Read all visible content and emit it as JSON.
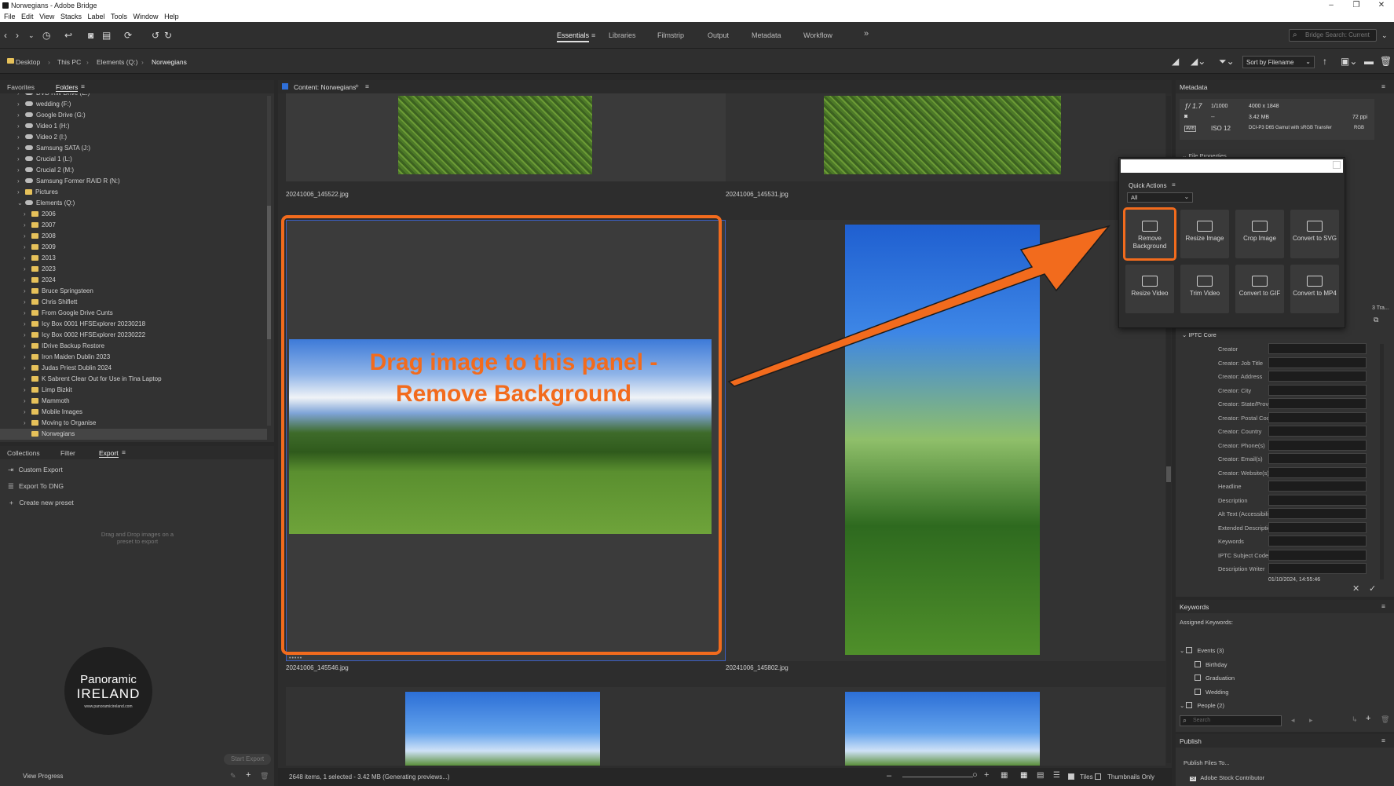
{
  "window": {
    "title": "Norwegians - Adobe Bridge"
  },
  "menu": [
    "File",
    "Edit",
    "View",
    "Stacks",
    "Label",
    "Tools",
    "Window",
    "Help"
  ],
  "workspaces": [
    "Essentials",
    "Libraries",
    "Filmstrip",
    "Output",
    "Metadata",
    "Workflow"
  ],
  "search": {
    "placeholder": "Bridge Search: Current"
  },
  "breadcrumbs": [
    "Desktop",
    "This PC",
    "Elements (Q:)",
    "Norwegians"
  ],
  "sort": {
    "selected": "Sort by Filename"
  },
  "left": {
    "tabs": [
      "Favorites",
      "Folders"
    ],
    "folders": [
      {
        "label": "DVD RW Drive (E:)",
        "type": "drive",
        "indent": 1
      },
      {
        "label": "wedding (F:)",
        "type": "drive",
        "indent": 1
      },
      {
        "label": "Google Drive (G:)",
        "type": "drive",
        "indent": 1
      },
      {
        "label": "Video 1 (H:)",
        "type": "drive",
        "indent": 1
      },
      {
        "label": "Video 2 (I:)",
        "type": "drive",
        "indent": 1
      },
      {
        "label": "Samsung SATA (J:)",
        "type": "drive",
        "indent": 1
      },
      {
        "label": "Crucial 1 (L:)",
        "type": "drive",
        "indent": 1
      },
      {
        "label": "Crucial 2 (M:)",
        "type": "drive",
        "indent": 1
      },
      {
        "label": "Samsung Former RAID R (N:)",
        "type": "drive",
        "indent": 1
      },
      {
        "label": "Pictures",
        "type": "folder",
        "indent": 1
      },
      {
        "label": "Elements (Q:)",
        "type": "drive",
        "indent": 1,
        "open": true
      },
      {
        "label": "2006",
        "type": "folder",
        "indent": 2
      },
      {
        "label": "2007",
        "type": "folder",
        "indent": 2
      },
      {
        "label": "2008",
        "type": "folder",
        "indent": 2
      },
      {
        "label": "2009",
        "type": "folder",
        "indent": 2
      },
      {
        "label": "2013",
        "type": "folder",
        "indent": 2
      },
      {
        "label": "2023",
        "type": "folder",
        "indent": 2
      },
      {
        "label": "2024",
        "type": "folder",
        "indent": 2
      },
      {
        "label": "Bruce Springsteen",
        "type": "folder",
        "indent": 2
      },
      {
        "label": "Chris Shiflett",
        "type": "folder",
        "indent": 2
      },
      {
        "label": "From Google Drive Cunts",
        "type": "folder",
        "indent": 2
      },
      {
        "label": "Icy Box 0001 HFSExplorer 20230218",
        "type": "folder",
        "indent": 2
      },
      {
        "label": "Icy Box 0002 HFSExplorer 20230222",
        "type": "folder",
        "indent": 2
      },
      {
        "label": "IDrive Backup Restore",
        "type": "folder",
        "indent": 2
      },
      {
        "label": "Iron Maiden Dublin 2023",
        "type": "folder",
        "indent": 2
      },
      {
        "label": "Judas Priest Dublin 2024",
        "type": "folder",
        "indent": 2
      },
      {
        "label": "K Sabrent Clear Out for Use in Tina Laptop",
        "type": "folder",
        "indent": 2
      },
      {
        "label": "Limp Bizkit",
        "type": "folder",
        "indent": 2
      },
      {
        "label": "Mammoth",
        "type": "folder",
        "indent": 2
      },
      {
        "label": "Mobile Images",
        "type": "folder",
        "indent": 2
      },
      {
        "label": "Moving to Organise",
        "type": "folder",
        "indent": 2
      },
      {
        "label": "Norwegians",
        "type": "folder",
        "indent": 2,
        "selected": true
      }
    ],
    "bottom_tabs": [
      "Collections",
      "Filter",
      "Export"
    ],
    "export_items": [
      "Custom Export",
      "Export To DNG",
      "Create new preset"
    ],
    "drag_hint": "Drag and Drop images on a preset to export",
    "start_export": "Start Export",
    "view_progress": "View Progress",
    "logo": {
      "line1": "Panoramic",
      "line2": "IRELAND",
      "url": "www.panoramicireland.com"
    }
  },
  "content": {
    "header": "Content: Norwegians",
    "files": [
      "20241006_145522.jpg",
      "20241006_145531.jpg",
      "20241006_145546.jpg",
      "20241006_145802.jpg"
    ],
    "annotation": {
      "line1": "Drag image to this panel -",
      "line2": "Remove Background"
    },
    "status": "2648 items, 1 selected - 3.42 MB (Generating previews...)",
    "view_options": {
      "tiles": "Tiles",
      "thumbs_only": "Thumbnails Only"
    }
  },
  "metadata": {
    "header": "Metadata",
    "aperture": "ƒ/ 1.7",
    "shutter": "1/1000",
    "dims": "4000 x 1848",
    "size": "3.42 MB",
    "ppi": "72 ppi",
    "iso": "ISO 12",
    "dash": "--",
    "colorprofile": "DCI-P3 D65 Gamut with sRGB Transfer",
    "mode": "RGB",
    "awb": "AWB",
    "section_file": "File Properties",
    "section_iptc": "IPTC Core",
    "partial_right": "3 Tra...",
    "iptc_fields": [
      "Creator",
      "Creator: Job Title",
      "Creator: Address",
      "Creator: City",
      "Creator: State/Province",
      "Creator: Postal Code",
      "Creator: Country",
      "Creator: Phone(s)",
      "Creator: Email(s)",
      "Creator: Website(s)",
      "Headline",
      "Description",
      "Alt Text (Accessibility)",
      "Extended Description ...",
      "Keywords",
      "IPTC Subject Code",
      "Description Writer"
    ],
    "date_partial": "01/10/2024, 14:55:46"
  },
  "keywords": {
    "header": "Keywords",
    "assigned": "Assigned Keywords:",
    "tree": [
      {
        "label": "Events  (3)",
        "level": 0
      },
      {
        "label": "Birthday",
        "level": 1
      },
      {
        "label": "Graduation",
        "level": 1
      },
      {
        "label": "Wedding",
        "level": 1
      },
      {
        "label": "People  (2)",
        "level": 0
      }
    ],
    "search_placeholder": "Search"
  },
  "publish": {
    "header": "Publish",
    "files_to": "Publish Files To...",
    "service": "Adobe Stock Contributor"
  },
  "quick_actions": {
    "title": "Quick Actions",
    "filter": "All",
    "tiles": [
      "Remove Background",
      "Resize Image",
      "Crop Image",
      "Convert to SVG",
      "Resize Video",
      "Trim Video",
      "Convert to GIF",
      "Convert to MP4"
    ]
  },
  "colors": {
    "accent": "#f26b1d",
    "panel": "#323232",
    "selection": "#3b5fc4"
  }
}
